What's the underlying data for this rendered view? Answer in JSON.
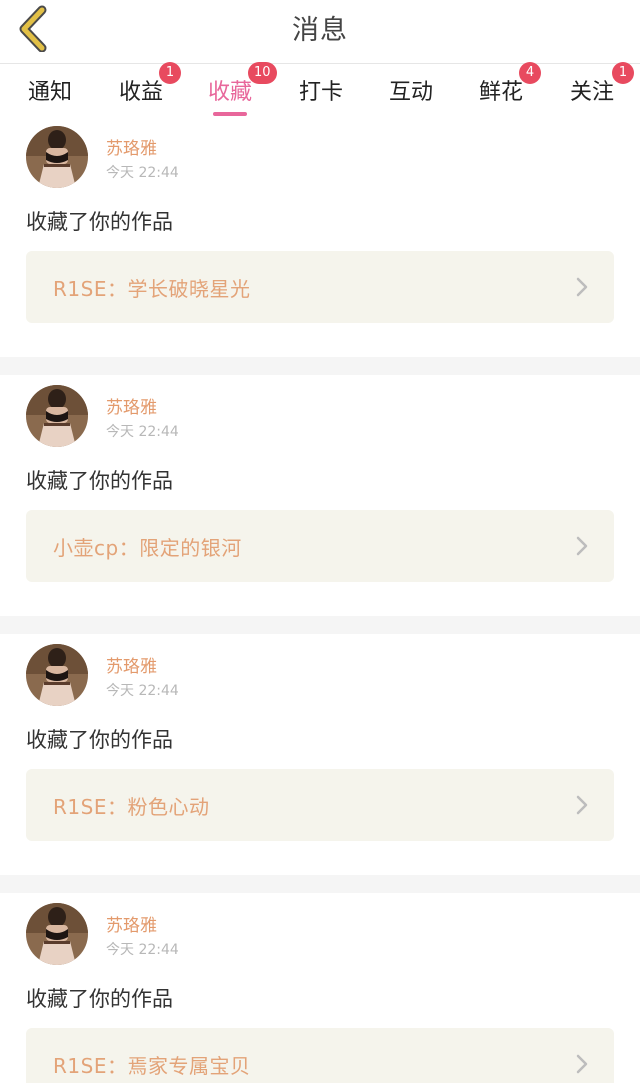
{
  "header": {
    "title": "消息",
    "back_icon": "chevron-left-icon"
  },
  "colors": {
    "accent": "#e8679b",
    "badge": "#e84a5f",
    "name": "#e39a6c",
    "work": "#e3a378",
    "back": "#e2c046"
  },
  "tabs": [
    {
      "label": "通知",
      "badge": ""
    },
    {
      "label": "收益",
      "badge": "1"
    },
    {
      "label": "收藏",
      "badge": "10",
      "active": true
    },
    {
      "label": "打卡",
      "badge": ""
    },
    {
      "label": "互动",
      "badge": ""
    },
    {
      "label": "鲜花",
      "badge": "4"
    },
    {
      "label": "关注",
      "badge": "1"
    }
  ],
  "items": [
    {
      "user": "苏珞雅",
      "time": "今天 22:44",
      "action": "收藏了你的作品",
      "work": "R1SE：学长破晓星光"
    },
    {
      "user": "苏珞雅",
      "time": "今天 22:44",
      "action": "收藏了你的作品",
      "work": "小壶cp：限定的银河"
    },
    {
      "user": "苏珞雅",
      "time": "今天 22:44",
      "action": "收藏了你的作品",
      "work": "R1SE：粉色心动"
    },
    {
      "user": "苏珞雅",
      "time": "今天 22:44",
      "action": "收藏了你的作品",
      "work": "R1SE：焉家专属宝贝"
    }
  ]
}
